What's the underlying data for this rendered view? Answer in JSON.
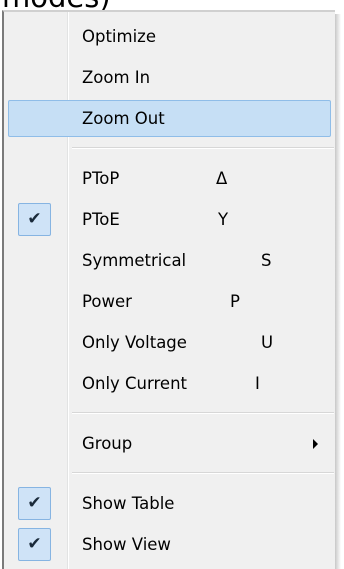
{
  "header_fragment": "modes)",
  "menu": {
    "items": [
      {
        "label": "Optimize",
        "shortcut": "",
        "checked": false,
        "highlighted": false
      },
      {
        "label": "Zoom In",
        "shortcut": "",
        "checked": false,
        "highlighted": false
      },
      {
        "label": "Zoom Out",
        "shortcut": "",
        "checked": false,
        "highlighted": true
      },
      {
        "label": "PToP",
        "shortcut": "Δ",
        "checked": false,
        "highlighted": false
      },
      {
        "label": "PToE",
        "shortcut": "Y",
        "checked": true,
        "highlighted": false
      },
      {
        "label": "Symmetrical",
        "shortcut": "S",
        "checked": false,
        "highlighted": false
      },
      {
        "label": "Power",
        "shortcut": "P",
        "checked": false,
        "highlighted": false
      },
      {
        "label": "Only Voltage",
        "shortcut": "U",
        "checked": false,
        "highlighted": false
      },
      {
        "label": "Only Current",
        "shortcut": "I",
        "checked": false,
        "highlighted": false
      },
      {
        "label": "Group",
        "shortcut": "",
        "checked": false,
        "highlighted": false,
        "submenu": true
      },
      {
        "label": "Show Table",
        "shortcut": "",
        "checked": true,
        "highlighted": false
      },
      {
        "label": "Show View",
        "shortcut": "",
        "checked": true,
        "highlighted": false
      }
    ],
    "check_glyph": "✔",
    "colors": {
      "menu_background": "#f0f0f0",
      "highlight_background": "#c6dff5",
      "highlight_border": "#8fbde8",
      "check_background": "#cfe3f7"
    }
  }
}
